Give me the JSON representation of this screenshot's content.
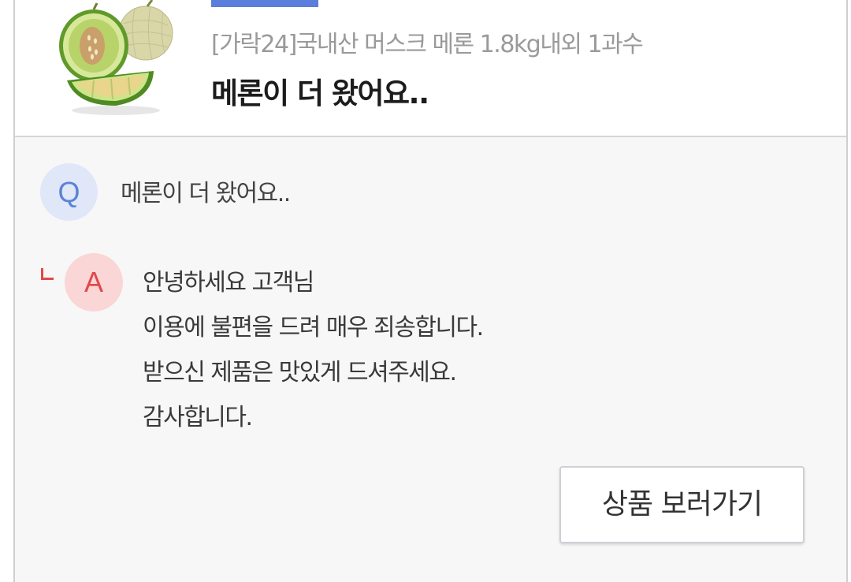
{
  "product": {
    "name": "[가락24]국내산 머스크 메론 1.8kg내외 1과수",
    "image_icon": "melon-product-image"
  },
  "review": {
    "title": "메론이 더 왔어요.."
  },
  "question": {
    "badge": "Q",
    "text": "메론이 더 왔어요.."
  },
  "answer": {
    "badge": "A",
    "lines": [
      "안녕하세요 고객님",
      "이용에 불편을 드려 매우 죄송합니다.",
      "받으신 제품은 맛있게 드셔주세요.",
      "감사합니다."
    ]
  },
  "actions": {
    "view_product_label": "상품 보러가기"
  },
  "colors": {
    "accent": "#5b7ddb",
    "question_badge_bg": "#dfe7f8",
    "question_badge_fg": "#5a82d8",
    "answer_badge_bg": "#fad6d6",
    "answer_badge_fg": "#e2474b",
    "section_bg": "#f7f7f7"
  }
}
